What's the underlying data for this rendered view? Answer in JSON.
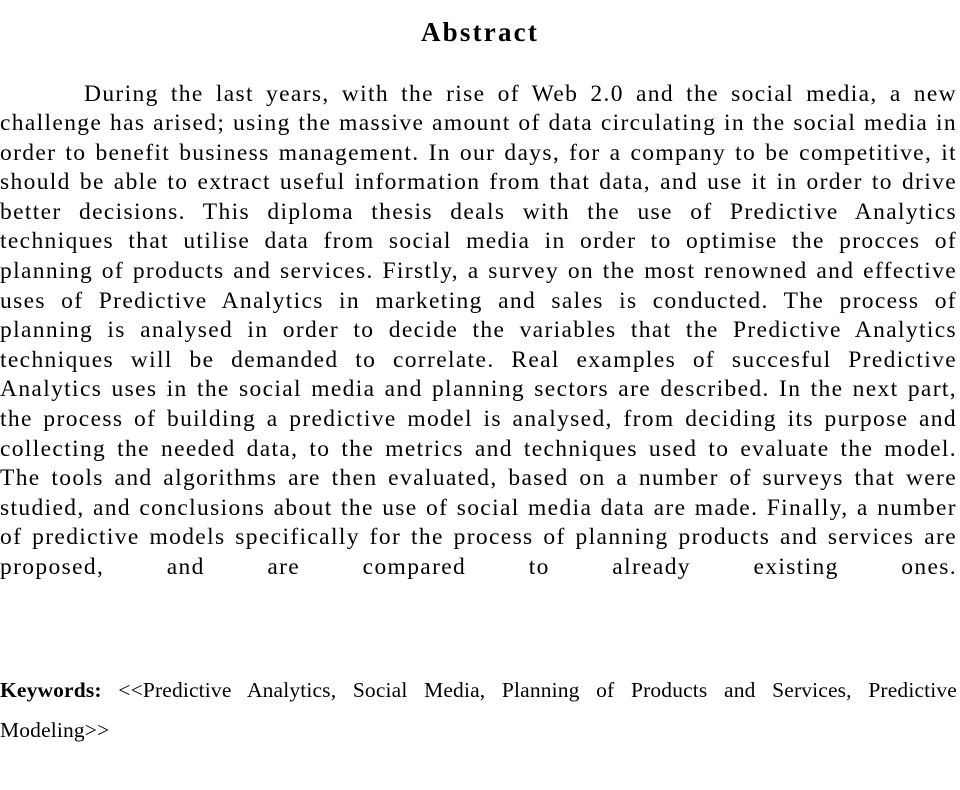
{
  "document": {
    "type": "thesis-abstract-page",
    "background_color": "#ffffff",
    "text_color": "#000000",
    "heading": "Abstract",
    "abstract_paragraph": "During the last years, with the rise of Web 2.0 and the social media, a new challenge has arised; using the massive amount of data circulating in the social media in order to benefit business management. In our days, for a company to be competitive, it should be able to extract useful information from that data, and use it in order to drive better decisions. This diploma thesis deals with the use of Predictive Analytics techniques that utilise data from social media in order to optimise the procces of planning of products and services. Firstly, a survey on the most renowned and effective uses of Predictive Analytics in marketing and sales is conducted. The process of planning is analysed in order to decide the variables that the Predictive Analytics techniques will be demanded to correlate. Real examples of succesful Predictive Analytics uses in the social media and planning sectors are described. In the next part, the process of building a predictive model is analysed, from deciding its purpose and collecting the needed data, to the metrics and techniques used to evaluate the model. The tools and algorithms are then evaluated, based on a number of surveys that were studied, and conclusions about the use of social media data are made. Finally, a number of predictive models specifically for the process of planning products and services are proposed, and are compared to already existing ones.",
    "keywords": {
      "label": "Keywords:",
      "value": "<<Predictive Analytics, Social Media, Planning of Products and Services, Predictive Modeling>>",
      "terms": [
        "Predictive Analytics",
        "Social Media",
        "Planning of Products and Services",
        "Predictive Modeling"
      ]
    }
  }
}
